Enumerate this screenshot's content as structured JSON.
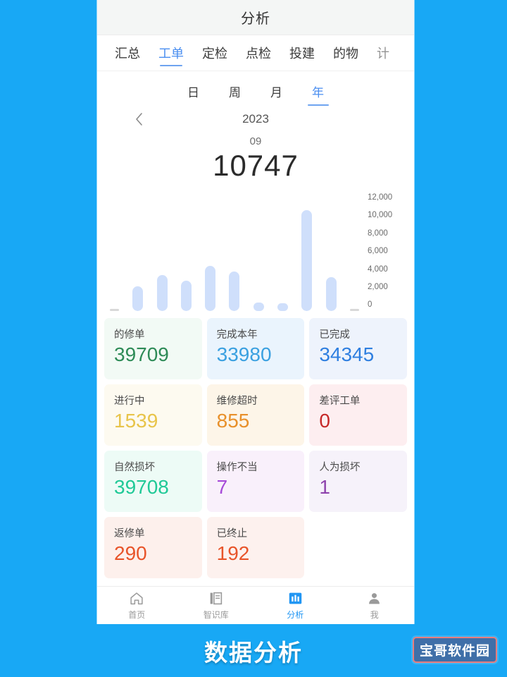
{
  "app": {
    "title": "分析"
  },
  "tabs": [
    {
      "label": "汇总",
      "active": false
    },
    {
      "label": "工单",
      "active": true
    },
    {
      "label": "定检",
      "active": false
    },
    {
      "label": "点检",
      "active": false
    },
    {
      "label": "投建",
      "active": false
    },
    {
      "label": "的物",
      "active": false
    },
    {
      "label": "计",
      "active": false,
      "clipped": true
    }
  ],
  "periods": [
    {
      "label": "日",
      "active": false
    },
    {
      "label": "周",
      "active": false
    },
    {
      "label": "月",
      "active": false
    },
    {
      "label": "年",
      "active": true
    }
  ],
  "datenav": {
    "prev_icon": "chevron-left-icon",
    "year": "2023",
    "month": "09",
    "total": "10747"
  },
  "chart_data": {
    "type": "bar",
    "title": "",
    "xlabel": "",
    "ylabel": "",
    "ylim": [
      0,
      12000
    ],
    "grid": false,
    "legend": null,
    "bar_color": "#cfdffb",
    "categories": [
      "",
      "",
      "",
      "",
      "",
      "",
      "",
      "",
      "",
      "",
      ""
    ],
    "values": [
      60,
      2600,
      3800,
      3200,
      4800,
      4200,
      900,
      800,
      10747,
      3600,
      0
    ],
    "ticks": [
      "12,000",
      "10,000",
      "8,000",
      "6,000",
      "4,000",
      "2,000",
      "0"
    ]
  },
  "stats": [
    {
      "label": "的修单",
      "value": "39709",
      "value_color": "#2e8b57",
      "bg": "#f2faf5"
    },
    {
      "label": "完成本年",
      "value": "33980",
      "value_color": "#3aa0e0",
      "bg": "#eaf4fd"
    },
    {
      "label": "已完成",
      "value": "34345",
      "value_color": "#2f7fe0",
      "bg": "#eef3fc"
    },
    {
      "label": "进行中",
      "value": "1539",
      "value_color": "#e8c44a",
      "bg": "#fdfaf0"
    },
    {
      "label": "维修超时",
      "value": "855",
      "value_color": "#e8902a",
      "bg": "#fdf5e8"
    },
    {
      "label": "差评工单",
      "value": "0",
      "value_color": "#c62828",
      "bg": "#fdeef0"
    },
    {
      "label": "自然损坏",
      "value": "39708",
      "value_color": "#20c997",
      "bg": "#edfbf6"
    },
    {
      "label": "操作不当",
      "value": "7",
      "value_color": "#a64ad8",
      "bg": "#f9f0fb"
    },
    {
      "label": "人为损坏",
      "value": "1",
      "value_color": "#8e44ad",
      "bg": "#f6f2fa"
    },
    {
      "label": "返修单",
      "value": "290",
      "value_color": "#e8542a",
      "bg": "#fdf0ec"
    },
    {
      "label": "已终止",
      "value": "192",
      "value_color": "#e8542a",
      "bg": "#fdf1ee"
    },
    {
      "label": "",
      "value": "",
      "value_color": "#ffffff",
      "bg": "transparent"
    }
  ],
  "bottom_nav": [
    {
      "label": "首页",
      "icon": "home-icon",
      "active": false
    },
    {
      "label": "智识库",
      "icon": "book-icon",
      "active": false
    },
    {
      "label": "分析",
      "icon": "bar-chart-icon",
      "active": true
    },
    {
      "label": "我",
      "icon": "person-icon",
      "active": false
    }
  ],
  "caption": {
    "text": "数据分析",
    "watermark": "宝哥软件园"
  },
  "colors": {
    "accent": "#2196f3",
    "background": "#18a8f5",
    "tab_active": "#4a8ef0"
  }
}
